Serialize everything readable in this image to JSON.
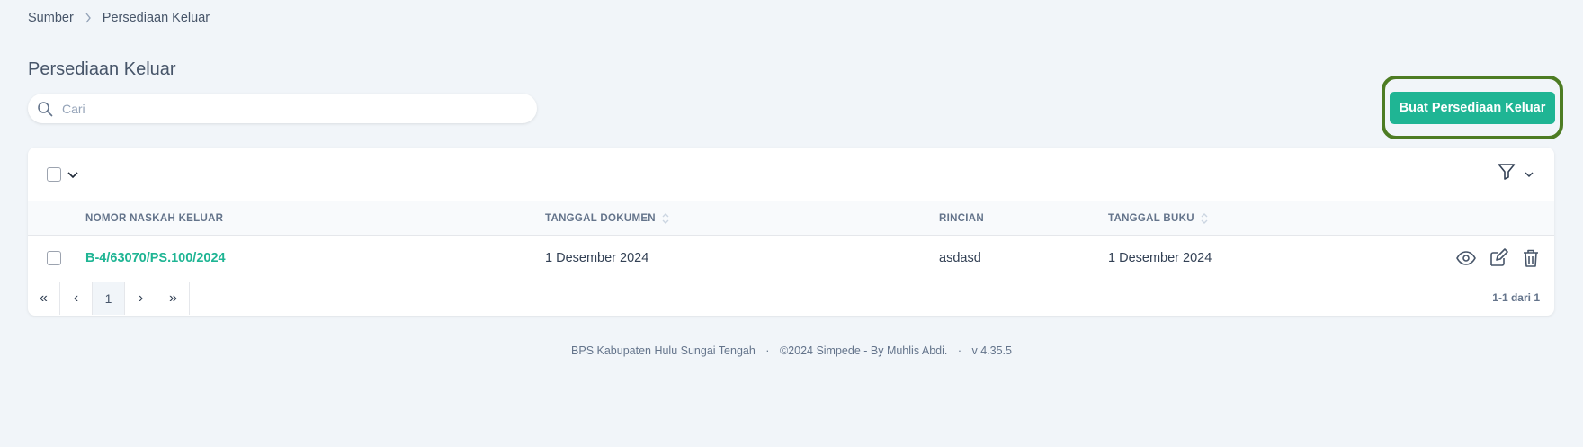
{
  "breadcrumb": {
    "items": [
      "Sumber",
      "Persediaan Keluar"
    ]
  },
  "page": {
    "title": "Persediaan Keluar"
  },
  "search": {
    "placeholder": "Cari",
    "value": ""
  },
  "actions": {
    "create_label": "Buat Persediaan Keluar"
  },
  "table": {
    "columns": {
      "nomor": "NOMOR NASKAH KELUAR",
      "tanggal_dokumen": "TANGGAL DOKUMEN",
      "rincian": "RINCIAN",
      "tanggal_buku": "TANGGAL BUKU"
    },
    "rows": [
      {
        "nomor": "B-4/63070/PS.100/2024",
        "tanggal_dokumen": "1 Desember 2024",
        "rincian": "asdasd",
        "tanggal_buku": "1 Desember 2024"
      }
    ]
  },
  "pagination": {
    "first": "«",
    "prev": "‹",
    "current": "1",
    "next": "›",
    "last": "»",
    "summary": "1-1 dari 1"
  },
  "footer": {
    "org": "BPS Kabupaten Hulu Sungai Tengah",
    "copyright": "©2024 Simpede - By Muhlis Abdi.",
    "version": "v 4.35.5"
  },
  "colors": {
    "accent": "#1fb594",
    "highlight_border": "#4d7c23",
    "background": "#f1f5f9"
  },
  "icons": {
    "search": "search-icon",
    "filter": "filter-icon",
    "view": "eye-icon",
    "edit": "edit-icon",
    "delete": "trash-icon"
  }
}
